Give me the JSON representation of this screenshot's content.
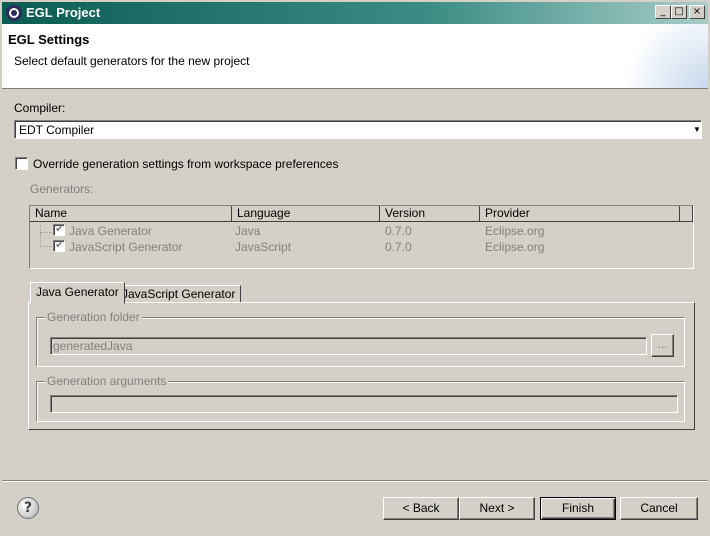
{
  "window": {
    "title": "EGL Project",
    "minimize_glyph": "_",
    "maximize_glyph": "□",
    "close_glyph": "×"
  },
  "header": {
    "title": "EGL Settings",
    "description": "Select default generators for the new project"
  },
  "compiler": {
    "label": "Compiler:",
    "value": "EDT Compiler"
  },
  "override": {
    "label": "Override generation settings from workspace preferences",
    "checked": false
  },
  "generators": {
    "label": "Generators:",
    "columns": [
      "Name",
      "Language",
      "Version",
      "Provider"
    ],
    "rows": [
      {
        "name": "Java Generator",
        "language": "Java",
        "version": "0.7.0",
        "provider": "Eclipse.org",
        "checked": true
      },
      {
        "name": "JavaScript Generator",
        "language": "JavaScript",
        "version": "0.7.0",
        "provider": "Eclipse.org",
        "checked": true
      }
    ]
  },
  "tabs": [
    {
      "label": "Java Generator",
      "active": true
    },
    {
      "label": "JavaScript Generator",
      "active": false
    }
  ],
  "generation_folder": {
    "label": "Generation folder",
    "value": "generatedJava",
    "browse_label": "..."
  },
  "generation_arguments": {
    "label": "Generation arguments",
    "value": ""
  },
  "buttons": {
    "back": "< Back",
    "next": "Next >",
    "finish": "Finish",
    "cancel": "Cancel",
    "help": "?"
  }
}
